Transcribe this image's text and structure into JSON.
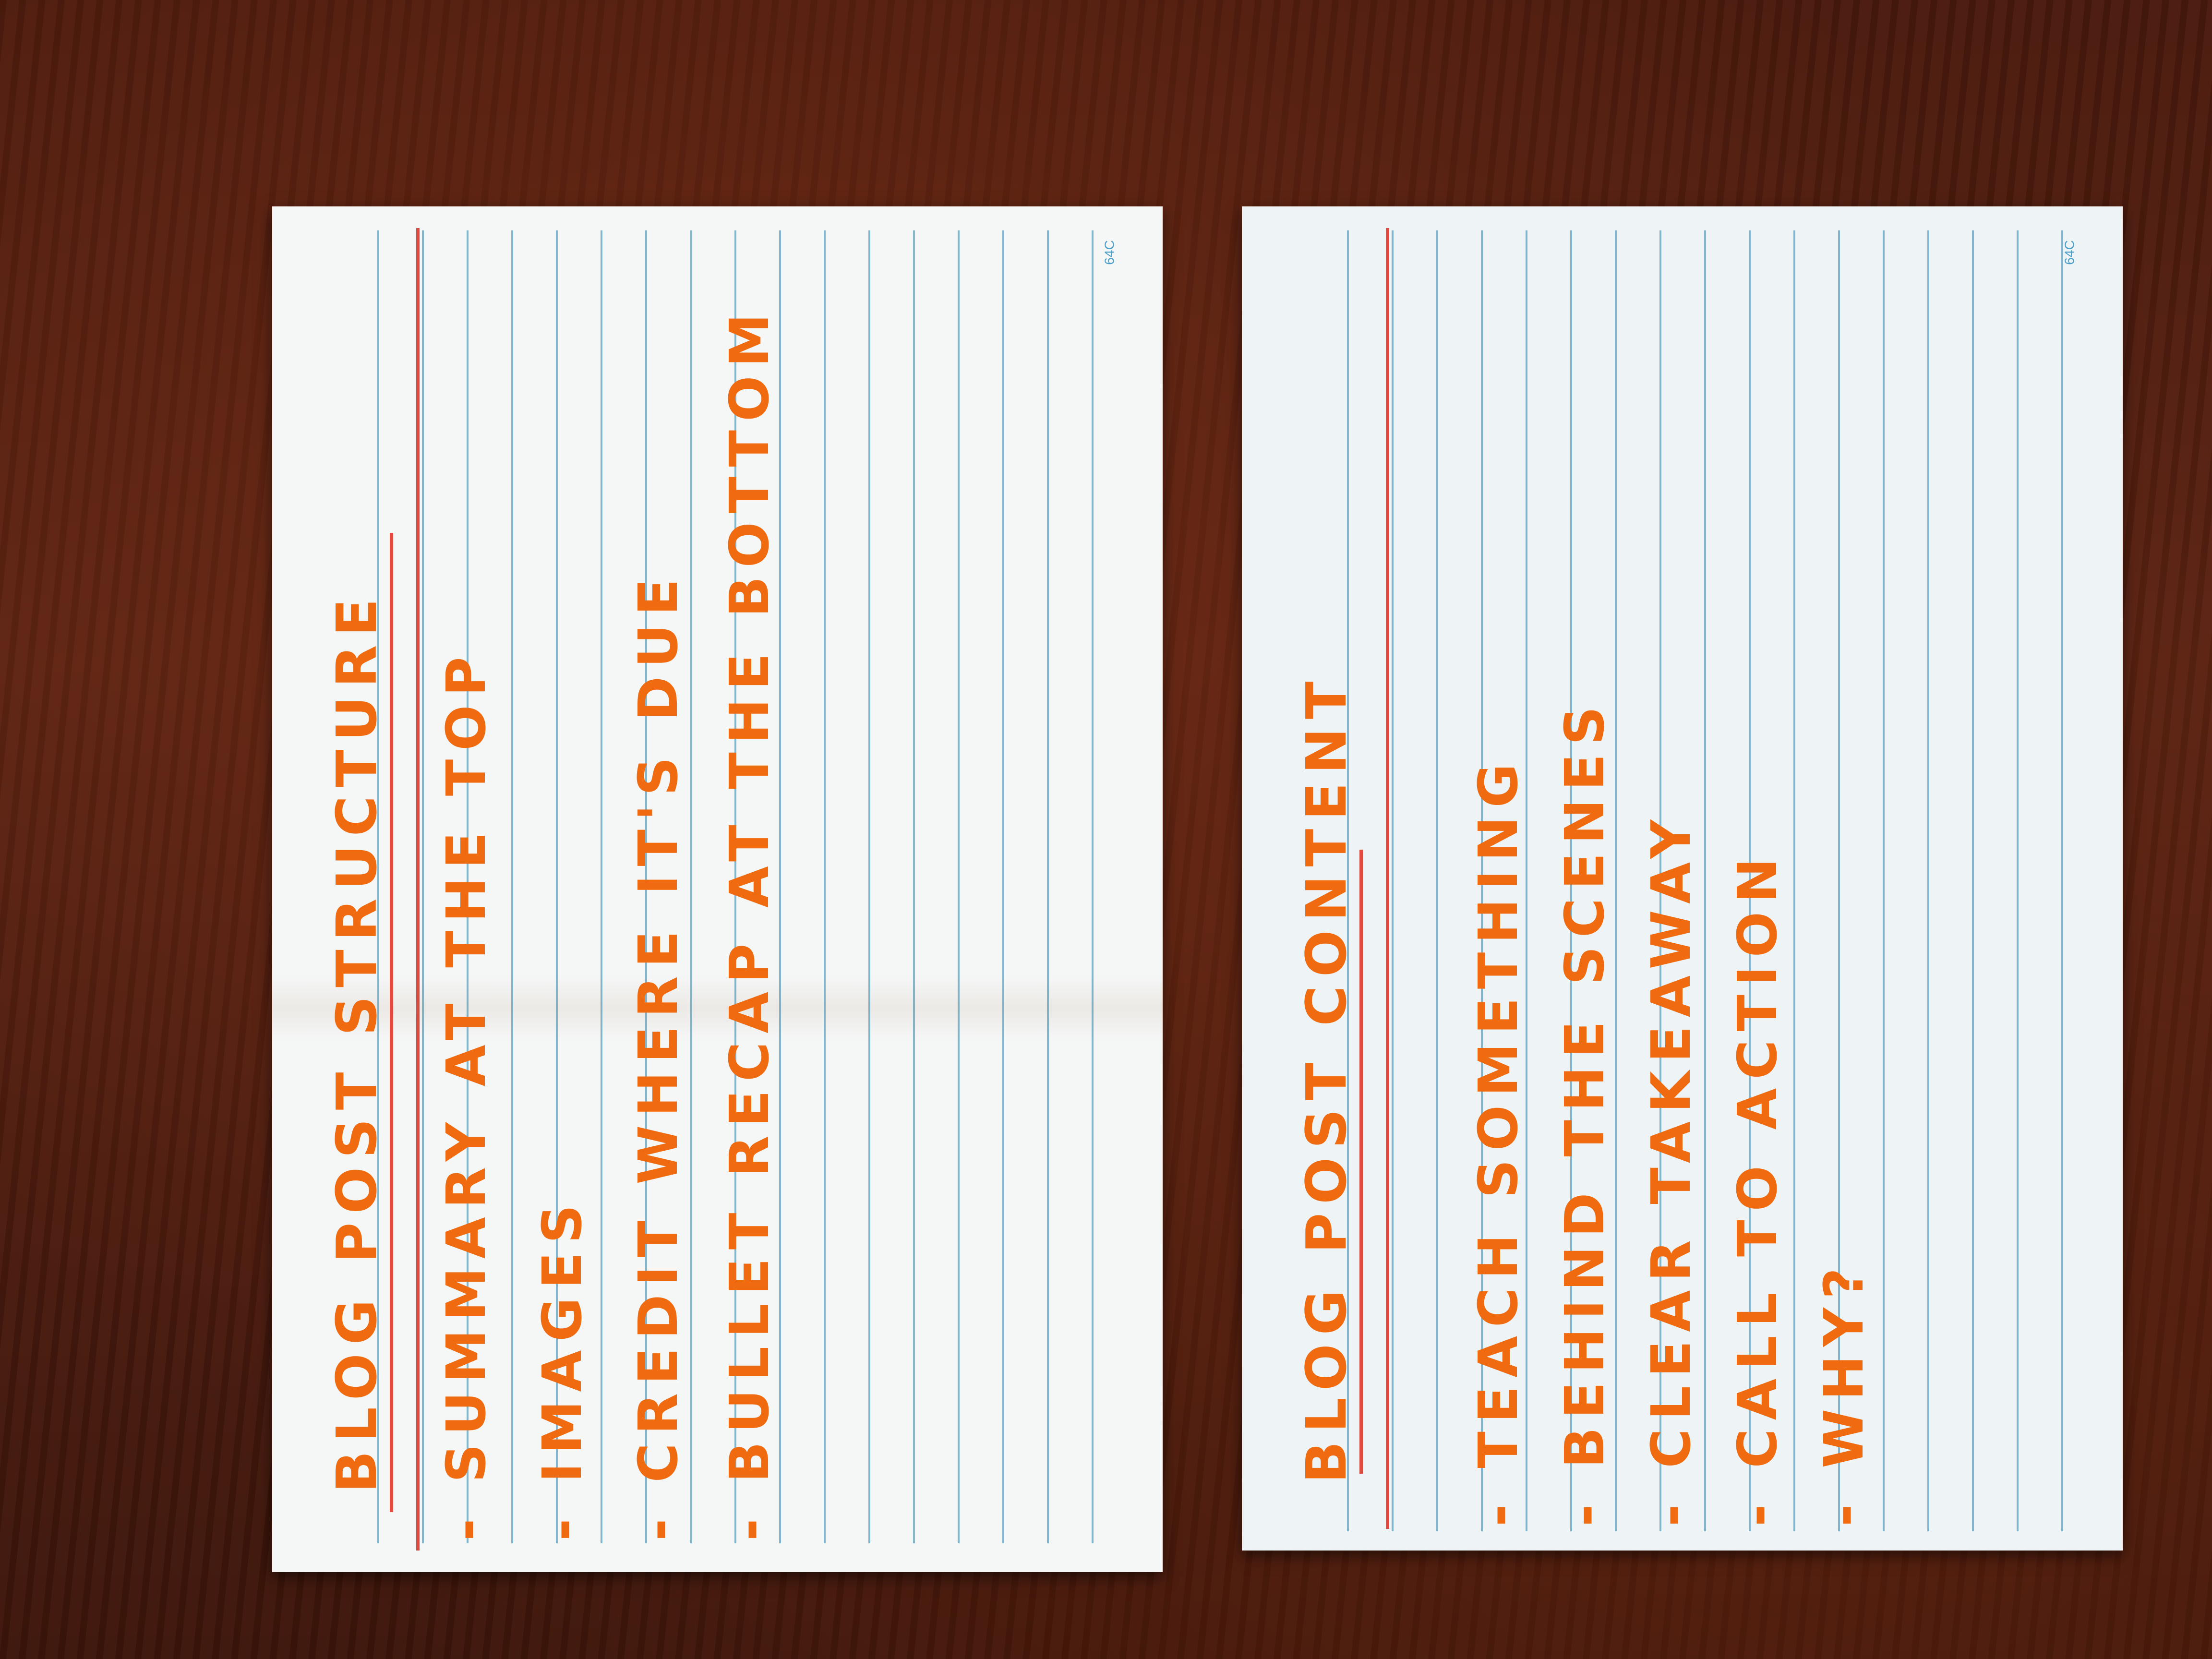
{
  "cards": [
    {
      "title": "BLOG POST STRUCTURE",
      "items": [
        "- SUMMARY AT THE TOP",
        "- IMAGES",
        "- CREDIT WHERE IT'S DUE",
        "- BULLET RECAP AT THE BOTTOM"
      ],
      "code": "64C"
    },
    {
      "title": "BLOG POST CONTENT",
      "items": [
        "- TEACH SOMETHING",
        "- BEHIND THE SCENES",
        "- CLEAR TAKEAWAY",
        "- CALL TO ACTION",
        "- WHY?"
      ],
      "code": "64C"
    }
  ],
  "colors": {
    "ink": "#f06a10",
    "margin_rule": "#e04a3f",
    "ruling": "#6eaac8",
    "table": "#4a1a0d"
  }
}
